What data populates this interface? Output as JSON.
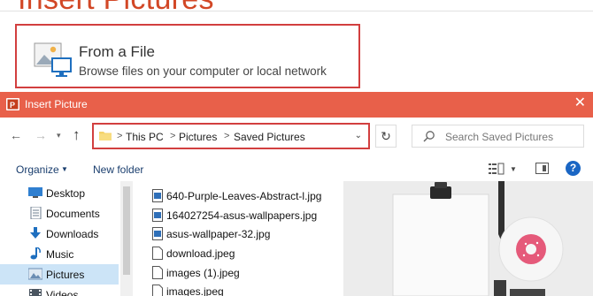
{
  "background_dialog": {
    "title": "Insert Pictures",
    "from_file": {
      "title": "From a File",
      "subtitle": "Browse files on your computer or local network"
    }
  },
  "window": {
    "title": "Insert Picture",
    "close_glyph": "✕",
    "nav": {
      "back_glyph": "←",
      "forward_glyph": "→",
      "recent_glyph": "▾",
      "up_glyph": "↑"
    },
    "address": {
      "crumbs": [
        "This PC",
        "Pictures",
        "Saved Pictures"
      ],
      "separator": ">",
      "dropdown_glyph": "⌄"
    },
    "refresh_glyph": "↻",
    "search": {
      "placeholder": "Search Saved Pictures"
    },
    "commands": {
      "organize": "Organize",
      "organize_arrow": "▼",
      "new_folder": "New folder",
      "view_dropdown_glyph": "▼",
      "help_glyph": "?"
    },
    "nav_items": [
      {
        "label": "Desktop",
        "icon": "desktop-icon",
        "selected": false
      },
      {
        "label": "Documents",
        "icon": "documents-icon",
        "selected": false
      },
      {
        "label": "Downloads",
        "icon": "downloads-icon",
        "selected": false
      },
      {
        "label": "Music",
        "icon": "music-icon",
        "selected": false
      },
      {
        "label": "Pictures",
        "icon": "pictures-icon",
        "selected": true
      },
      {
        "label": "Videos",
        "icon": "videos-icon",
        "selected": false
      }
    ],
    "files": [
      {
        "name": "640-Purple-Leaves-Abstract-l.jpg",
        "icon": "image-file-icon"
      },
      {
        "name": "164027254-asus-wallpapers.jpg",
        "icon": "image-file-icon"
      },
      {
        "name": "asus-wallpaper-32.jpg",
        "icon": "image-file-icon"
      },
      {
        "name": "download.jpeg",
        "icon": "blank-file-icon"
      },
      {
        "name": "images (1).jpeg",
        "icon": "blank-file-icon"
      },
      {
        "name": "images.jpeg",
        "icon": "blank-file-icon"
      }
    ]
  },
  "colors": {
    "accent_orange": "#e8604a",
    "highlight_red": "#d23f3f",
    "title_orange": "#d24726",
    "selection_blue": "#cce4f7",
    "link_blue": "#1a3e6e"
  }
}
